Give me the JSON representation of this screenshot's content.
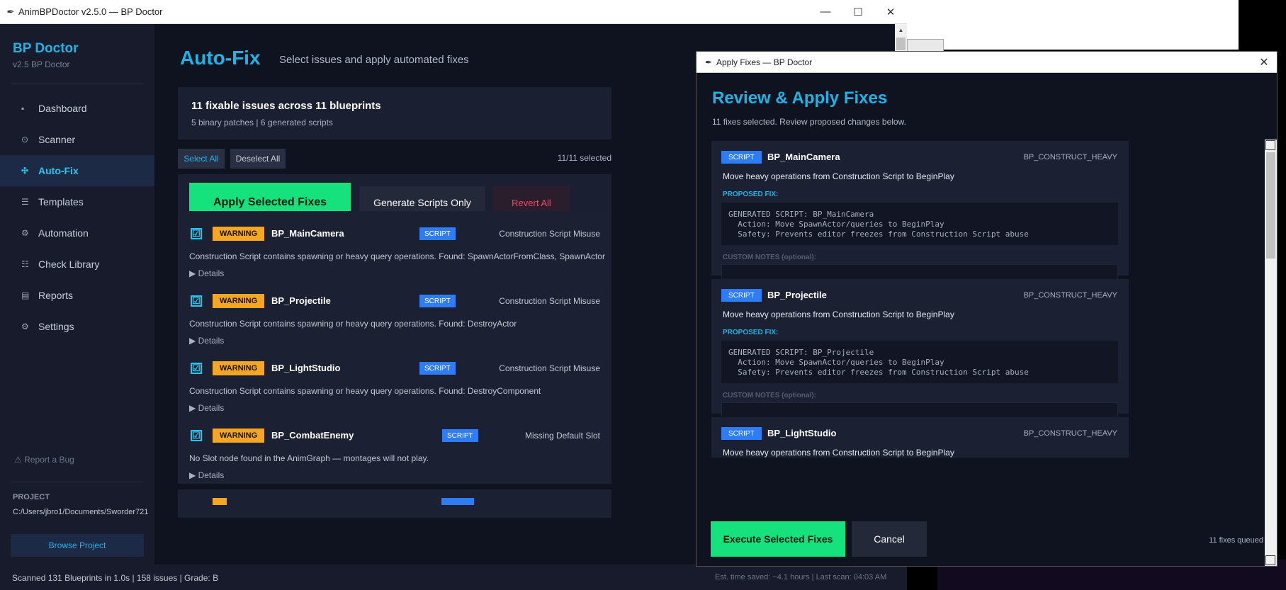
{
  "main_window": {
    "title": "AnimBPDoctor v2.5.0 — BP Doctor",
    "controls": {
      "minimize": "—",
      "maximize": "☐",
      "close": "✕"
    }
  },
  "sidebar": {
    "brand": "BP Doctor",
    "version": "v2.5  BP Doctor",
    "items": [
      {
        "label": "Dashboard",
        "icon": "▪"
      },
      {
        "label": "Scanner",
        "icon": "⊙"
      },
      {
        "label": "Auto-Fix",
        "icon": "✣"
      },
      {
        "label": "Templates",
        "icon": "☰"
      },
      {
        "label": "Automation",
        "icon": "⚙"
      },
      {
        "label": "Check Library",
        "icon": "☷"
      },
      {
        "label": "Reports",
        "icon": "▤"
      },
      {
        "label": "Settings",
        "icon": "⚙"
      }
    ],
    "active_item": "Auto-Fix",
    "report_bug": "Report a Bug",
    "report_bug_icon": "⚠",
    "project_label": "PROJECT",
    "project_path": "C:/Users/jbro1/Documents/Sworder721",
    "browse_label": "Browse Project"
  },
  "page": {
    "title": "Auto-Fix",
    "subtitle": "Select issues and apply automated fixes",
    "summary_title": "11 fixable issues across 11 blueprints",
    "summary_detail": "5 binary patches | 6 generated scripts",
    "select_all": "Select All",
    "deselect_all": "Deselect All",
    "selected_count": "11/11 selected",
    "apply_label": "Apply Selected Fixes",
    "generate_label": "Generate Scripts Only",
    "revert_label": "Revert All"
  },
  "issues": [
    {
      "severity": "WARNING",
      "name": "BP_MainCamera",
      "tag": "SCRIPT",
      "category": "Construction Script Misuse",
      "description": "Construction Script contains spawning or heavy query operations. Found: SpawnActorFromClass, SpawnActor",
      "details": "▶ Details",
      "checked": "☑"
    },
    {
      "severity": "WARNING",
      "name": "BP_Projectile",
      "tag": "SCRIPT",
      "category": "Construction Script Misuse",
      "description": "Construction Script contains spawning or heavy query operations. Found: DestroyActor",
      "details": "▶ Details",
      "checked": "☑"
    },
    {
      "severity": "WARNING",
      "name": "BP_LightStudio",
      "tag": "SCRIPT",
      "category": "Construction Script Misuse",
      "description": "Construction Script contains spawning or heavy query operations. Found: DestroyComponent",
      "details": "▶ Details",
      "checked": "☑"
    },
    {
      "severity": "WARNING",
      "name": "BP_CombatEnemy",
      "tag": "SCRIPT",
      "category": "Missing Default Slot",
      "description": "No Slot node found in the AnimGraph — montages will not play.",
      "details": "▶ Details",
      "checked": "☑"
    }
  ],
  "statusbar": {
    "left": "Scanned 131 Blueprints in 1.0s | 158 issues | Grade: B",
    "right": "Est. time saved: ~4.1 hours | Last scan: 04:03 AM"
  },
  "dialog": {
    "title": "Apply Fixes — BP Doctor",
    "close": "✕",
    "heading": "Review & Apply Fixes",
    "subtitle": "11 fixes selected. Review proposed changes below.",
    "proposed_label": "PROPOSED FIX:",
    "notes_label": "CUSTOM NOTES (optional):",
    "fixes": [
      {
        "tag": "SCRIPT",
        "name": "BP_MainCamera",
        "code": "BP_CONSTRUCT_HEAVY",
        "description": "Move heavy operations from Construction Script to BeginPlay",
        "script": "GENERATED SCRIPT: BP_MainCamera\n  Action: Move SpawnActor/queries to BeginPlay\n  Safety: Prevents editor freezes from Construction Script abuse"
      },
      {
        "tag": "SCRIPT",
        "name": "BP_Projectile",
        "code": "BP_CONSTRUCT_HEAVY",
        "description": "Move heavy operations from Construction Script to BeginPlay",
        "script": "GENERATED SCRIPT: BP_Projectile\n  Action: Move SpawnActor/queries to BeginPlay\n  Safety: Prevents editor freezes from Construction Script abuse"
      },
      {
        "tag": "SCRIPT",
        "name": "BP_LightStudio",
        "code": "BP_CONSTRUCT_HEAVY",
        "description": "Move heavy operations from Construction Script to BeginPlay"
      }
    ],
    "execute_label": "Execute Selected Fixes",
    "cancel_label": "Cancel",
    "queued": "11 fixes queued"
  }
}
